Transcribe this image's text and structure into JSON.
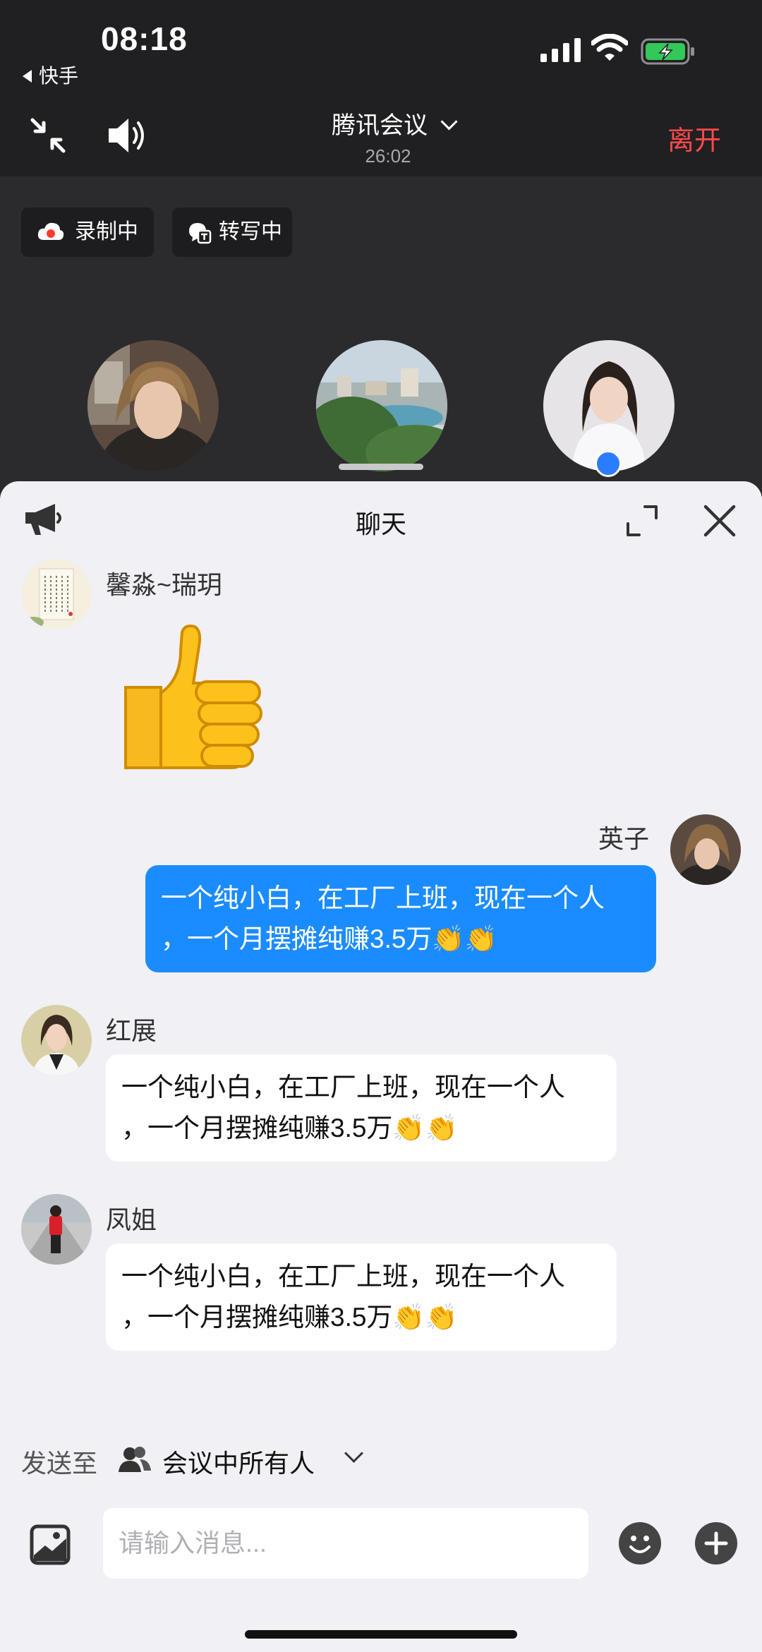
{
  "status": {
    "time": "08:18",
    "back_app": "快手"
  },
  "meeting": {
    "title": "腾讯会议",
    "elapsed": "26:02",
    "leave_label": "离开",
    "chips": [
      {
        "label": "录制中"
      },
      {
        "label": "转写中"
      }
    ]
  },
  "chat": {
    "title": "聊天",
    "messages": [
      {
        "sender": "馨淼~瑞玥",
        "type": "emoji",
        "content": "thumbs-up",
        "side": "left"
      },
      {
        "sender": "英子",
        "type": "text",
        "line1": "一个纯小白，在工厂上班，现在一个人",
        "line2": "，一个月摆摊纯赚3.5万👏👏",
        "side": "right"
      },
      {
        "sender": "红展",
        "type": "text",
        "line1": "一个纯小白，在工厂上班，现在一个人",
        "line2": "，一个月摆摊纯赚3.5万👏👏",
        "side": "left"
      },
      {
        "sender": "凤姐",
        "type": "text",
        "line1": "一个纯小白，在工厂上班，现在一个人",
        "line2": "，一个月摆摊纯赚3.5万👏👏",
        "side": "left"
      }
    ],
    "send_to_label": "发送至",
    "send_target": "会议中所有人",
    "input_placeholder": "请输入消息..."
  },
  "colors": {
    "accent": "#1b8cff",
    "leave": "#ff4a4a",
    "battery": "#34c759"
  }
}
